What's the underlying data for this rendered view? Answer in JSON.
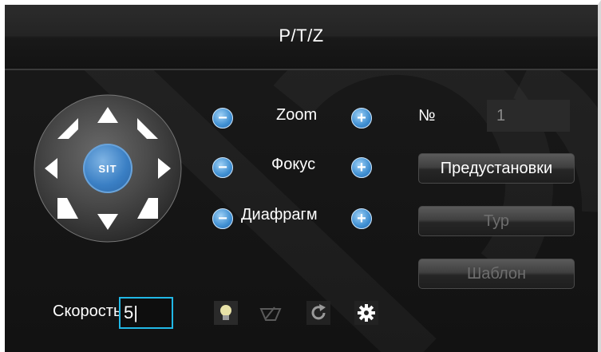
{
  "window": {
    "title": "P/T/Z"
  },
  "joystick": {
    "center_label": "SIT",
    "directions": [
      "up",
      "up-right",
      "right",
      "down-right",
      "down",
      "down-left",
      "left",
      "up-left"
    ]
  },
  "controls": {
    "zoom": {
      "label": "Zoom",
      "minus": "−",
      "plus": "+"
    },
    "focus": {
      "label": "Фокус",
      "minus": "−",
      "plus": "+"
    },
    "iris": {
      "label": "Диафрагм",
      "minus": "−",
      "plus": "+"
    }
  },
  "preset": {
    "number_label": "№",
    "number_value": "1"
  },
  "buttons": {
    "presets": "Предустановки",
    "tour": "Тур",
    "pattern": "Шаблон"
  },
  "speed": {
    "label": "Скорость",
    "value": "5|"
  },
  "tools": [
    "light-bulb-icon",
    "wiper-icon",
    "auto-rotate-icon",
    "settings-gear-icon"
  ],
  "colors": {
    "accent_blue": "#3f8fd2",
    "input_focus": "#21b8e6",
    "background": "#121212"
  }
}
